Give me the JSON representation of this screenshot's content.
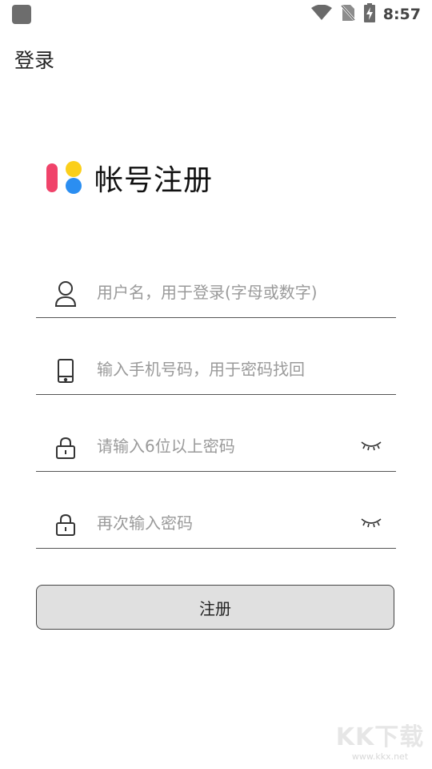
{
  "status_bar": {
    "time": "8:57",
    "icons": [
      "wifi-icon",
      "no-sim-icon",
      "battery-charging-icon"
    ]
  },
  "nav": {
    "back_label": "登录"
  },
  "header": {
    "title": "帐号注册",
    "logo_colors": {
      "red": "#f0436a",
      "yellow": "#fbcf1b",
      "blue": "#2b8ef1"
    }
  },
  "form": {
    "username": {
      "placeholder": "用户名，用于登录(字母或数字)",
      "icon": "user-icon"
    },
    "phone": {
      "placeholder": "输入手机号码，用于密码找回",
      "icon": "phone-icon"
    },
    "password": {
      "placeholder": "请输入6位以上密码",
      "icon": "lock-icon",
      "toggle_icon": "eye-closed-icon"
    },
    "confirm_password": {
      "placeholder": "再次输入密码",
      "icon": "lock-icon",
      "toggle_icon": "eye-closed-icon"
    },
    "submit_label": "注册"
  },
  "watermark": {
    "main": "KK下载",
    "sub": "www.kkx.net"
  }
}
